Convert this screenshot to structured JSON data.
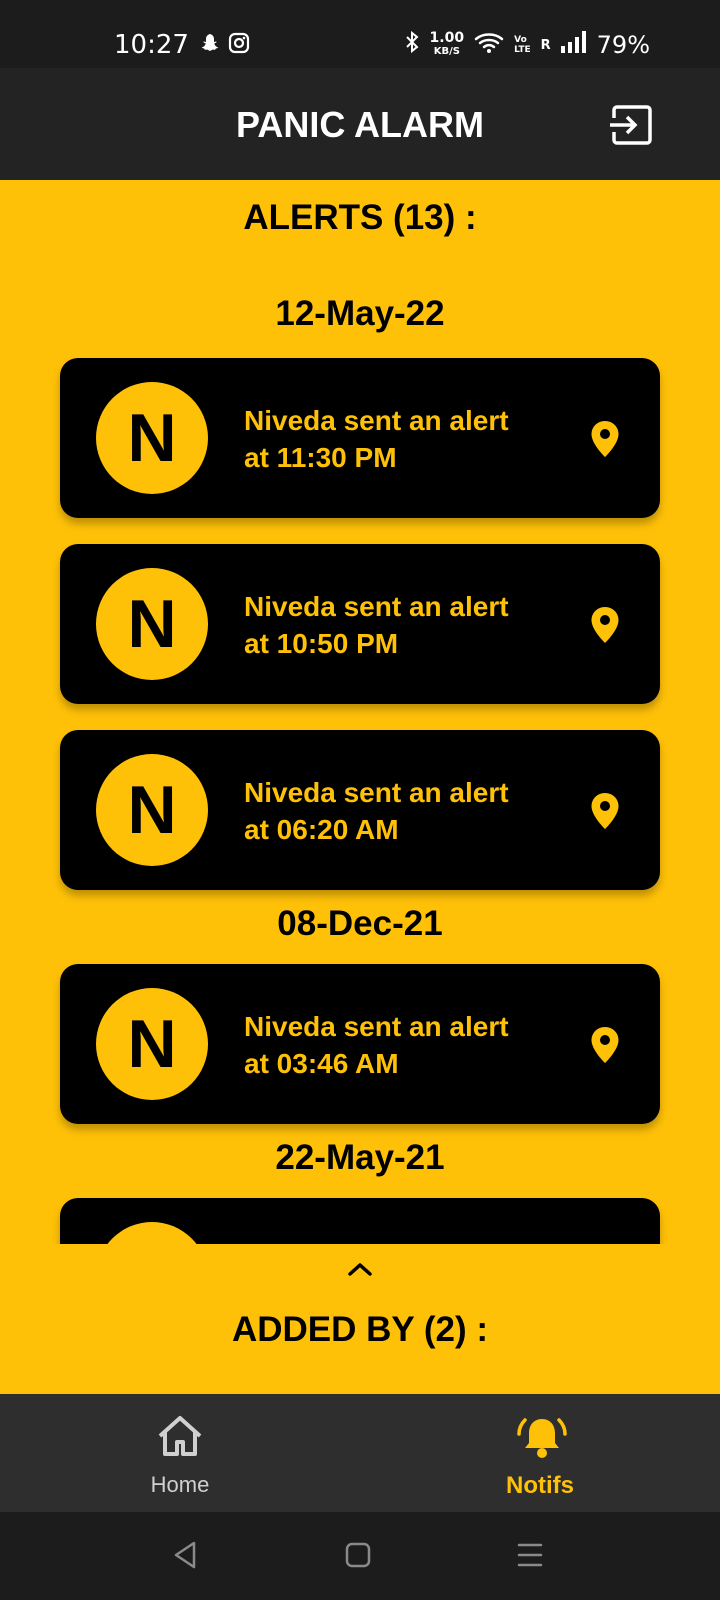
{
  "status_bar": {
    "time": "10:27",
    "net_speed_value": "1.00",
    "net_speed_unit": "KB/S",
    "volte_top": "Vo",
    "volte_bottom": "LTE",
    "roaming": "R",
    "battery": "79%",
    "icons": [
      "snapchat-icon",
      "instagram-icon",
      "bluetooth-icon",
      "wifi-icon",
      "signal-icon"
    ]
  },
  "app_bar": {
    "title": "PANIC ALARM",
    "logout_icon": "logout-icon"
  },
  "alerts_title": "ALERTS (13) :",
  "groups": [
    {
      "date": "12-May-22",
      "alerts": [
        {
          "initial": "N",
          "line1": "Niveda sent an alert",
          "line2": "at 11:30 PM"
        },
        {
          "initial": "N",
          "line1": "Niveda sent an alert",
          "line2": "at 10:50 PM"
        },
        {
          "initial": "N",
          "line1": "Niveda sent an alert",
          "line2": "at 06:20 AM"
        }
      ]
    },
    {
      "date": "08-Dec-21",
      "alerts": [
        {
          "initial": "N",
          "line1": "Niveda sent an alert",
          "line2": "at 03:46 AM"
        }
      ]
    },
    {
      "date": "22-May-21",
      "alerts": []
    }
  ],
  "added_by_title": "ADDED BY (2) :",
  "bottom_nav": {
    "home_label": "Home",
    "notifs_label": "Notifs",
    "active": "Notifs"
  },
  "colors": {
    "accent": "#FFC107",
    "card": "#000000",
    "app_bar": "#232323",
    "nav": "#2e2e2e"
  }
}
